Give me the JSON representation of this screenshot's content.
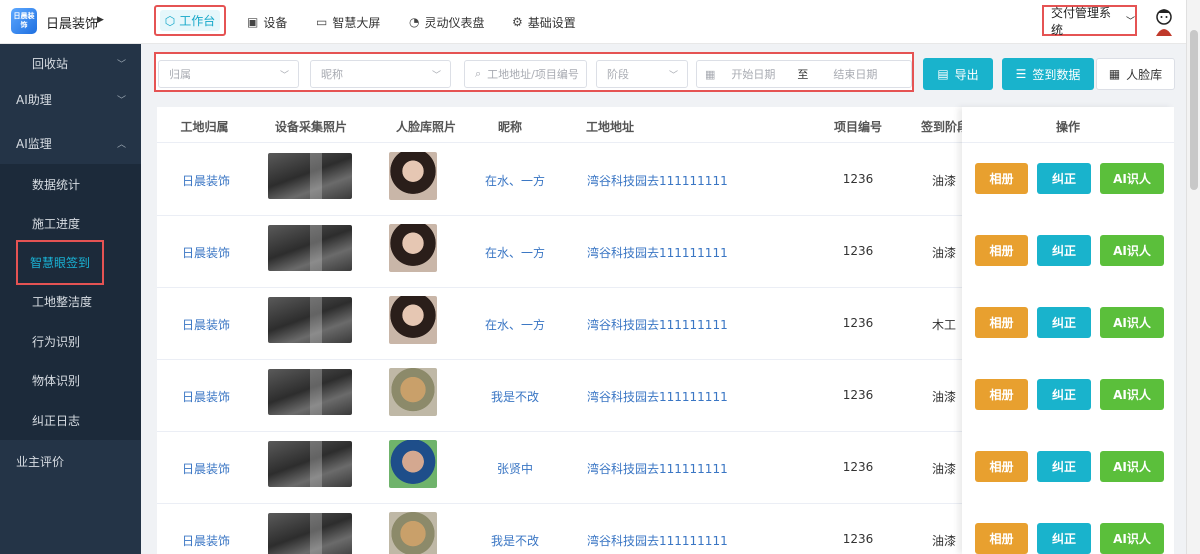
{
  "header": {
    "logo_text": "日晨装饰",
    "brand": "日晨装饰",
    "nav": [
      {
        "label": "工作台",
        "icon": "cube-icon"
      },
      {
        "label": "设备",
        "icon": "device-icon"
      },
      {
        "label": "智慧大屏",
        "icon": "monitor-icon"
      },
      {
        "label": "灵动仪表盘",
        "icon": "dashboard-icon"
      },
      {
        "label": "基础设置",
        "icon": "gear-icon"
      }
    ],
    "system_select": "交付管理系统"
  },
  "sidebar": {
    "top_items": [
      {
        "label": "回收站"
      },
      {
        "label": "AI助理"
      },
      {
        "label": "AI监理"
      }
    ],
    "sub_items": [
      {
        "label": "数据统计"
      },
      {
        "label": "施工进度"
      },
      {
        "label": "智慧眼签到"
      },
      {
        "label": "工地整洁度"
      },
      {
        "label": "行为识别"
      },
      {
        "label": "物体识别"
      },
      {
        "label": "纠正日志"
      }
    ],
    "bottom_item": {
      "label": "业主评价"
    }
  },
  "filters": {
    "belong_placeholder": "归属",
    "nickname_placeholder": "昵称",
    "address_placeholder": "工地地址/项目编号",
    "stage_placeholder": "阶段",
    "start_date_placeholder": "开始日期",
    "range_sep": "至",
    "end_date_placeholder": "结束日期"
  },
  "actions": {
    "export": "导出",
    "checkin_data": "签到数据",
    "face_library": "人脸库"
  },
  "table": {
    "columns": [
      "工地归属",
      "设备采集照片",
      "人脸库照片",
      "昵称",
      "工地地址",
      "项目编号",
      "签到阶段",
      "操作"
    ],
    "rows": [
      {
        "belong": "日晨装饰",
        "nickname": "在水、一方",
        "address": "湾谷科技园去111111111",
        "project_no": "1236",
        "stage": "油漆",
        "face": "a"
      },
      {
        "belong": "日晨装饰",
        "nickname": "在水、一方",
        "address": "湾谷科技园去111111111",
        "project_no": "1236",
        "stage": "油漆",
        "face": "a"
      },
      {
        "belong": "日晨装饰",
        "nickname": "在水、一方",
        "address": "湾谷科技园去111111111",
        "project_no": "1236",
        "stage": "木工",
        "face": "a"
      },
      {
        "belong": "日晨装饰",
        "nickname": "我是不改",
        "address": "湾谷科技园去111111111",
        "project_no": "1236",
        "stage": "油漆",
        "face": "b"
      },
      {
        "belong": "日晨装饰",
        "nickname": "张贤中",
        "address": "湾谷科技园去111111111",
        "project_no": "1236",
        "stage": "油漆",
        "face": "c"
      },
      {
        "belong": "日晨装饰",
        "nickname": "我是不改",
        "address": "湾谷科技园去111111111",
        "project_no": "1236",
        "stage": "油漆",
        "face": "b"
      }
    ],
    "op_labels": {
      "album": "相册",
      "correct": "纠正",
      "ai": "AI识人"
    }
  }
}
